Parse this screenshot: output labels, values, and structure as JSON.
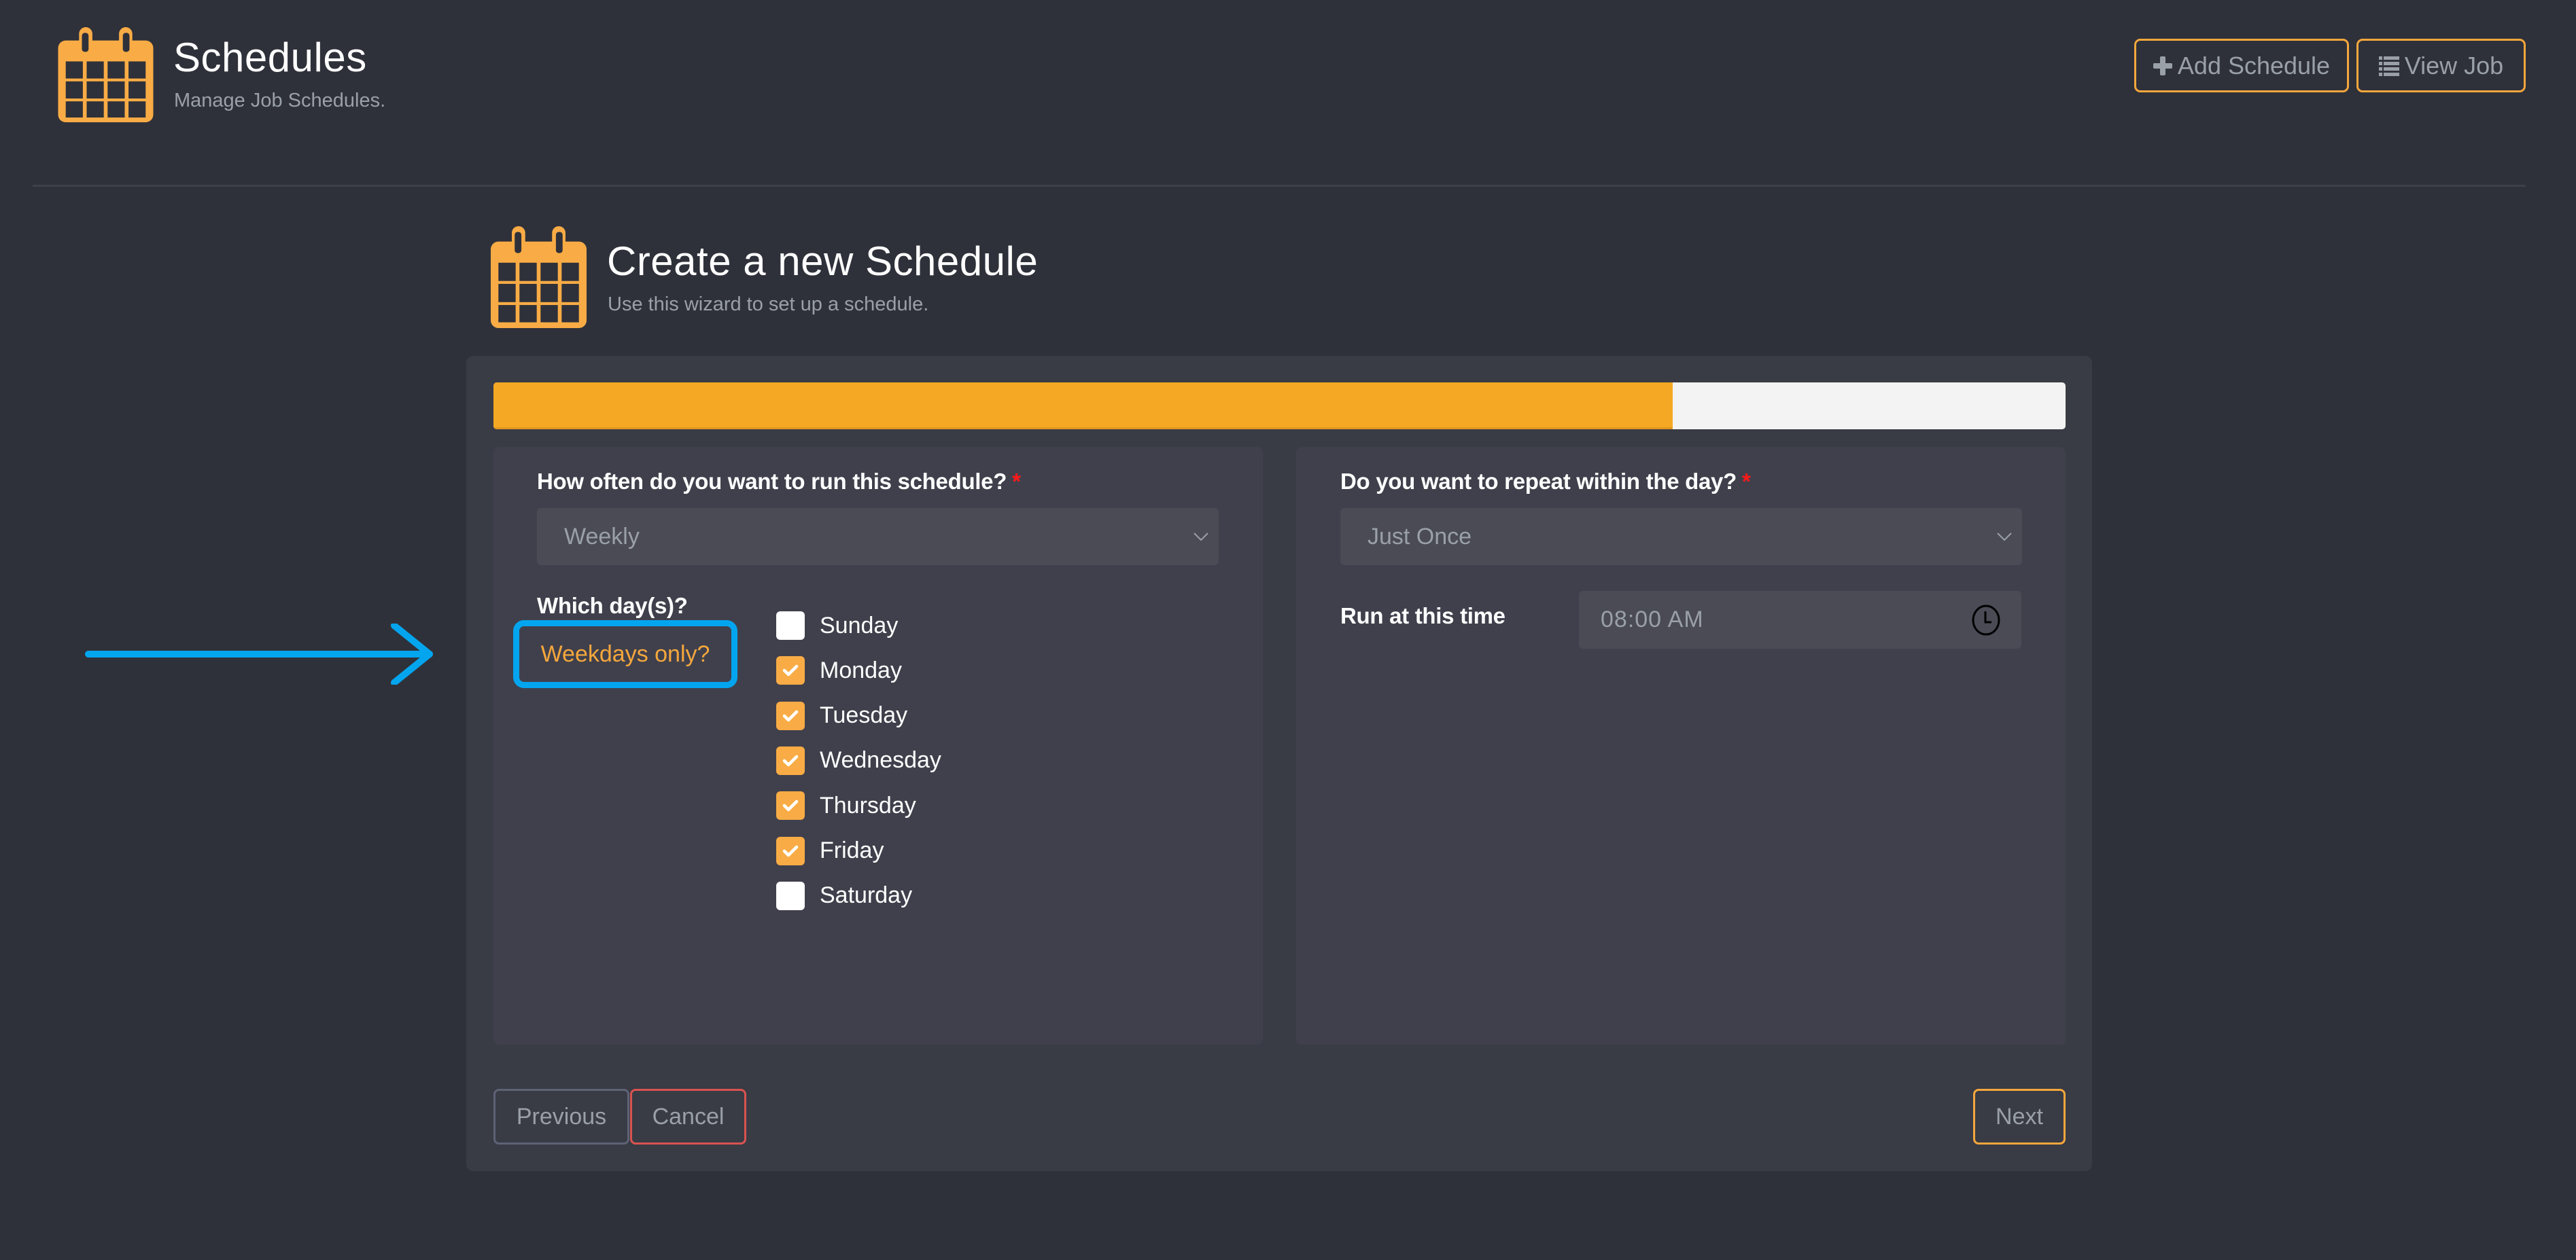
{
  "header": {
    "title": "Schedules",
    "subtitle": "Manage Job Schedules.",
    "icon": "calendar-icon",
    "buttons": {
      "add_schedule": {
        "label": "Add Schedule",
        "icon": "plus-icon"
      },
      "view_job": {
        "label": "View Job",
        "icon": "list-icon"
      }
    }
  },
  "wizard": {
    "title": "Create a new Schedule",
    "subtitle": "Use this wizard to set up a schedule.",
    "icon": "calendar-icon",
    "progress_percent": 75,
    "frequency": {
      "label": "How often do you want to run this schedule?",
      "required_mark": "*",
      "value": "Weekly"
    },
    "days": {
      "label": "Which day(s)?",
      "weekdays_link": "Weekdays only?",
      "items": [
        {
          "label": "Sunday",
          "checked": false
        },
        {
          "label": "Monday",
          "checked": true
        },
        {
          "label": "Tuesday",
          "checked": true
        },
        {
          "label": "Wednesday",
          "checked": true
        },
        {
          "label": "Thursday",
          "checked": true
        },
        {
          "label": "Friday",
          "checked": true
        },
        {
          "label": "Saturday",
          "checked": false
        }
      ]
    },
    "repeat": {
      "label": "Do you want to repeat within the day?",
      "required_mark": "*",
      "value": "Just Once"
    },
    "run_time": {
      "label": "Run at this time",
      "value": "08:00 AM",
      "icon": "clock-icon"
    },
    "buttons": {
      "previous": "Previous",
      "cancel": "Cancel",
      "next": "Next"
    }
  },
  "annotation": {
    "arrow_color": "#04a5ef",
    "highlight_color": "#04a5ef"
  },
  "colors": {
    "accent": "#f5a73c",
    "progress": "#f5a823",
    "danger": "#d9534f",
    "required": "#ff1a1a",
    "background": "#2f313a"
  }
}
